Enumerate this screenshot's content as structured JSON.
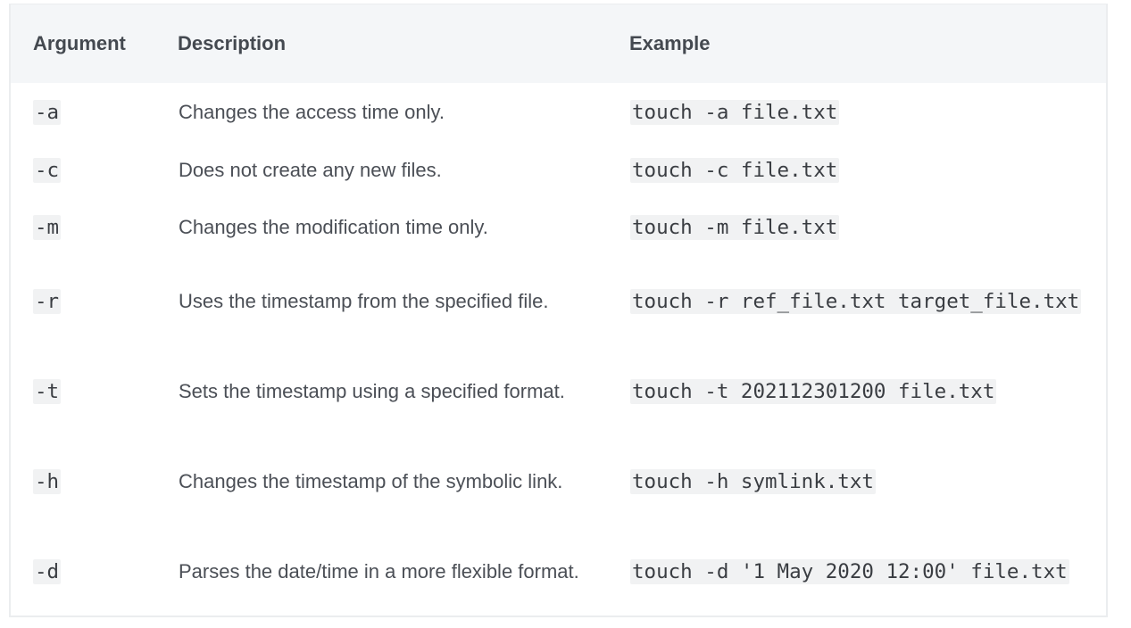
{
  "table": {
    "headers": {
      "argument": "Argument",
      "description": "Description",
      "example": "Example"
    },
    "rows": [
      {
        "argument": "-a",
        "description": "Changes the access time only.",
        "example": "touch -a file.txt"
      },
      {
        "argument": "-c",
        "description": "Does not create any new files.",
        "example": "touch -c file.txt"
      },
      {
        "argument": "-m",
        "description": "Changes the modification time only.",
        "example": "touch -m file.txt"
      },
      {
        "argument": "-r",
        "description": "Uses the timestamp from the specified file.",
        "example": "touch -r ref_file.txt target_file.txt"
      },
      {
        "argument": "-t",
        "description": "Sets the timestamp using a specified format.",
        "example": "touch -t 202112301200 file.txt"
      },
      {
        "argument": "-h",
        "description": "Changes the timestamp of the symbolic link.",
        "example": "touch -h symlink.txt"
      },
      {
        "argument": "-d",
        "description": "Parses the date/time in a more flexible format.",
        "example": "touch -d '1 May 2020 12:00' file.txt"
      }
    ]
  }
}
